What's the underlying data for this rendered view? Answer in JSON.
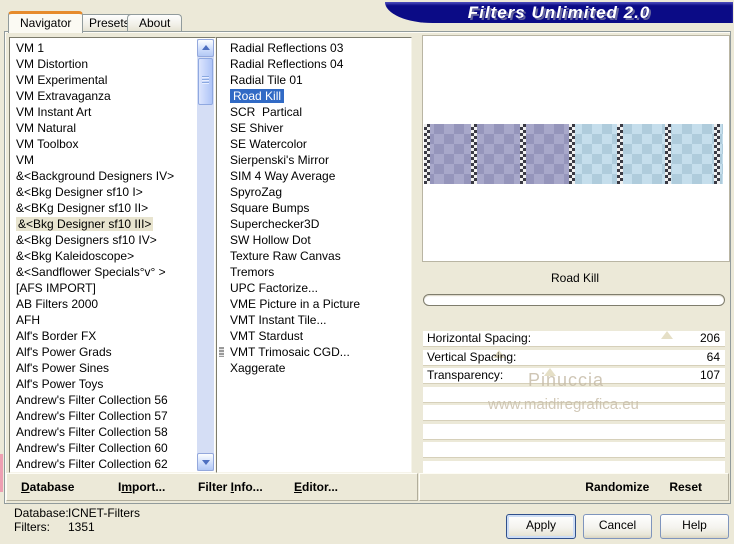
{
  "banner": {
    "title": "Filters Unlimited 2.0"
  },
  "tabs": [
    {
      "label": "Navigator",
      "active": true
    },
    {
      "label": "Presets",
      "active": false
    },
    {
      "label": "About",
      "active": false
    }
  ],
  "category_list": {
    "selected_index": 11,
    "items": [
      "VM 1",
      "VM Distortion",
      "VM Experimental",
      "VM Extravaganza",
      "VM Instant Art",
      "VM Natural",
      "VM Toolbox",
      "VM",
      "&<Background Designers IV>",
      "&<Bkg Designer sf10 I>",
      "&<BKg Designer sf10 II>",
      "&<Bkg Designer sf10 III>",
      "&<Bkg Designers sf10 IV>",
      "&<Bkg Kaleidoscope>",
      "&<Sandflower Specials°v° >",
      "[AFS IMPORT]",
      "AB Filters 2000",
      "AFH",
      "Alf's Border FX",
      "Alf's Power Grads",
      "Alf's Power Sines",
      "Alf's Power Toys",
      "Andrew's Filter Collection 56",
      "Andrew's Filter Collection 57",
      "Andrew's Filter Collection 58",
      "Andrew's Filter Collection 60",
      "Andrew's Filter Collection 62"
    ]
  },
  "filter_list": {
    "selected_index": 3,
    "icon_item_index": 19,
    "items": [
      "Radial Reflections 03",
      "Radial Reflections 04",
      "Radial Tile 01",
      "Road Kill",
      "SCR  Partical",
      "SE Shiver",
      "SE Watercolor",
      "Sierpenski's Mirror",
      "SIM 4 Way Average",
      "SpyroZag",
      "Square Bumps",
      "Superchecker3D",
      "SW Hollow Dot",
      "Texture Raw Canvas",
      "Tremors",
      "UPC Factorize...",
      "VME Picture in a Picture",
      "VMT Instant Tile...",
      "VMT Stardust",
      "VMT Trimosaic CGD...",
      "Xaggerate"
    ]
  },
  "preview": {
    "filter_name": "Road Kill"
  },
  "parameters": [
    {
      "label": "Horizontal Spacing:",
      "value": "206",
      "position_pct": 80.8
    },
    {
      "label": "Vertical Spacing:",
      "value": "64",
      "position_pct": 25.1
    },
    {
      "label": "Transparency:",
      "value": "107",
      "position_pct": 42.0
    }
  ],
  "empty_param_rows": 5,
  "watermark": {
    "line1": "Pinuccia",
    "line2": "www.maidiregrafica.eu"
  },
  "command_bar": {
    "left_items": [
      {
        "pre": "",
        "u": "D",
        "post": "atabase"
      },
      {
        "pre": "I",
        "u": "m",
        "post": "port..."
      },
      {
        "pre": "Filter ",
        "u": "I",
        "post": "nfo..."
      },
      {
        "pre": "",
        "u": "E",
        "post": "ditor..."
      }
    ],
    "right_items": [
      {
        "pre": "",
        "u": "",
        "post": "Randomize"
      },
      {
        "pre": "",
        "u": "",
        "post": "Reset"
      }
    ]
  },
  "status": {
    "database_label": "Database:",
    "database_value": "ICNET-Filters",
    "filters_label": "Filters:",
    "filters_value": "1351"
  },
  "buttons": [
    {
      "label": "Apply",
      "default": true
    },
    {
      "label": "Cancel",
      "default": false
    },
    {
      "label": "Help",
      "default": false
    }
  ],
  "colors": {
    "selection_blue": "#316ac5",
    "category_highlight": "#e8e4cf",
    "banner_navy": "#0b0b86",
    "tab_accent_orange": "#e68b2c",
    "band_purple_light": "#a8a8ca",
    "band_purple_dark": "#9595bb",
    "band_blue_light": "#c5deec",
    "band_blue_dark": "#afccdc"
  }
}
